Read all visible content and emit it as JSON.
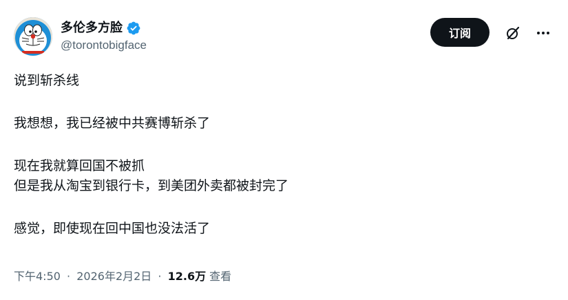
{
  "author": {
    "display_name": "多伦多方脸",
    "handle": "@torontobigface",
    "verified": true
  },
  "actions": {
    "subscribe_label": "订阅",
    "grok_icon": "grok-icon",
    "more_icon": "more-icon"
  },
  "body": {
    "paragraphs": [
      [
        "说到斩杀线"
      ],
      [
        "我想想，我已经被中共赛博斩杀了"
      ],
      [
        "现在我就算回国不被抓",
        "但是我从淘宝到银行卡，到美团外卖都被封完了"
      ],
      [
        "感觉，即使现在回中国也没法活了"
      ]
    ]
  },
  "meta": {
    "time": "下午4:50",
    "date": "2026年2月2日",
    "separator": "·",
    "views_count": "12.6万",
    "views_label": "查看"
  },
  "colors": {
    "text_primary": "#0f1419",
    "text_secondary": "#536471",
    "verified_blue": "#1d9bf0",
    "button_bg": "#0f1419"
  }
}
